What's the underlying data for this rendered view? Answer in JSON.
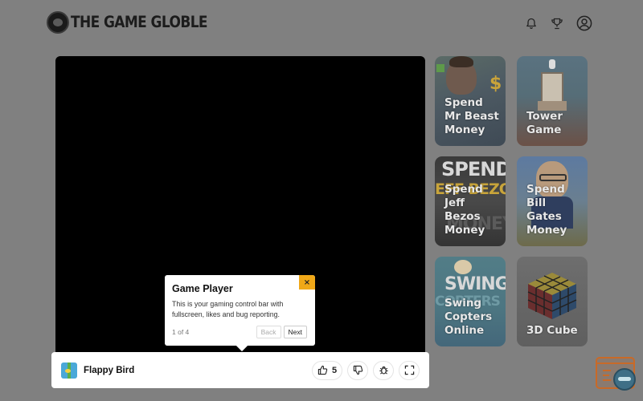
{
  "header": {
    "logo_text": "THE GAME GLOBLE",
    "icons": [
      "bell-icon",
      "trophy-icon",
      "user-account-icon"
    ]
  },
  "player": {
    "game_name": "Flappy Bird",
    "like_count": "5",
    "controls": [
      "thumbs-up-icon",
      "thumbs-down-icon",
      "bug-icon",
      "fullscreen-icon"
    ]
  },
  "tooltip": {
    "title": "Game Player",
    "body": "This is your gaming control bar with fullscreen, likes and bug reporting.",
    "step": "1 of 4",
    "back_label": "Back",
    "next_label": "Next",
    "close_label": "×"
  },
  "games": [
    {
      "title": "Spend Mr Beast Money"
    },
    {
      "title": "Tower Game"
    },
    {
      "title": "Spend Jeff Bezos Money"
    },
    {
      "title": "Spend Bill Gates Money"
    },
    {
      "title": "Swing Copters Online"
    },
    {
      "title": "3D Cube"
    }
  ],
  "card_art_text": {
    "spend": "SPEND",
    "bezos": "EFF BEZO",
    "money": "MONEY",
    "swing": "SWING",
    "copters": "COPTERS"
  },
  "colors": {
    "overlay": "#808080",
    "accent": "#f0a818",
    "chat_accent": "#c86a28"
  }
}
